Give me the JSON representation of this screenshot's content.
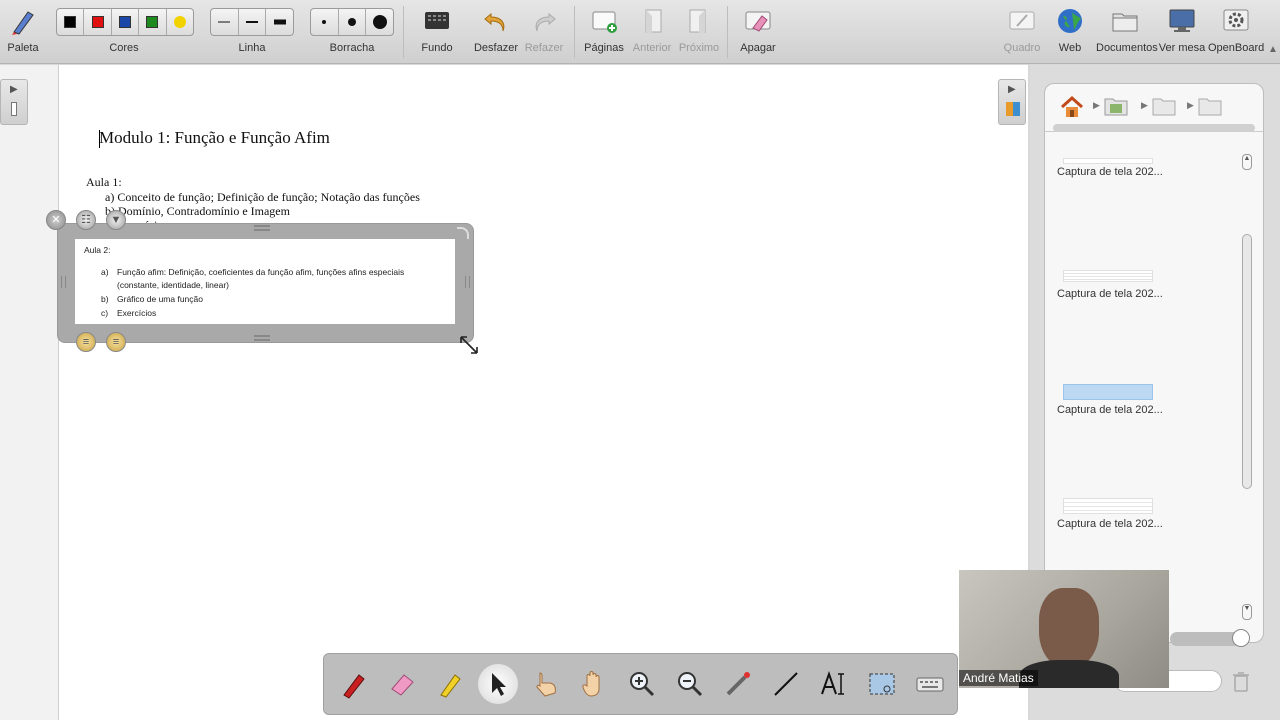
{
  "toolbar": {
    "palette_label": "Paleta",
    "colors_label": "Cores",
    "colors": [
      "#000000",
      "#e01010",
      "#1a47a8",
      "#1f8a1f",
      "#f2d200"
    ],
    "line_label": "Linha",
    "eraser_label": "Borracha",
    "background_label": "Fundo",
    "undo_label": "Desfazer",
    "redo_label": "Refazer",
    "pages_label": "Páginas",
    "previous_label": "Anterior",
    "next_label": "Próximo",
    "erase_label": "Apagar",
    "board_label": "Quadro",
    "web_label": "Web",
    "documents_label": "Documentos",
    "desktop_label": "Ver mesa",
    "app_label": "OpenBoard"
  },
  "document": {
    "title": "Modulo 1: Função e Função Afim",
    "lesson1": "Aula 1:",
    "item_a": "a)   Conceito de função; Definição de função; Notação das funções",
    "item_b": "b)   Domínio, Contradomínio e Imagem",
    "item_c": "c)   Exercícios"
  },
  "widget": {
    "lesson2": "Aula 2:",
    "a_marker": "a)",
    "a_text": "Função afim: Definição, coeficientes da função afim, funções afins especiais",
    "a_text2": "(constante, identidade, linear)",
    "b_marker": "b)",
    "b_text": "Gráfico de uma função",
    "c_marker": "c)",
    "c_text": "Exercícios"
  },
  "library": {
    "items": [
      {
        "label": "Captura de tela 202..."
      },
      {
        "label": "Captura de tela 202..."
      },
      {
        "label": "Captura de tela 202..."
      },
      {
        "label": "Captura de tela 202..."
      }
    ]
  },
  "webcam": {
    "name": "André Matias"
  }
}
